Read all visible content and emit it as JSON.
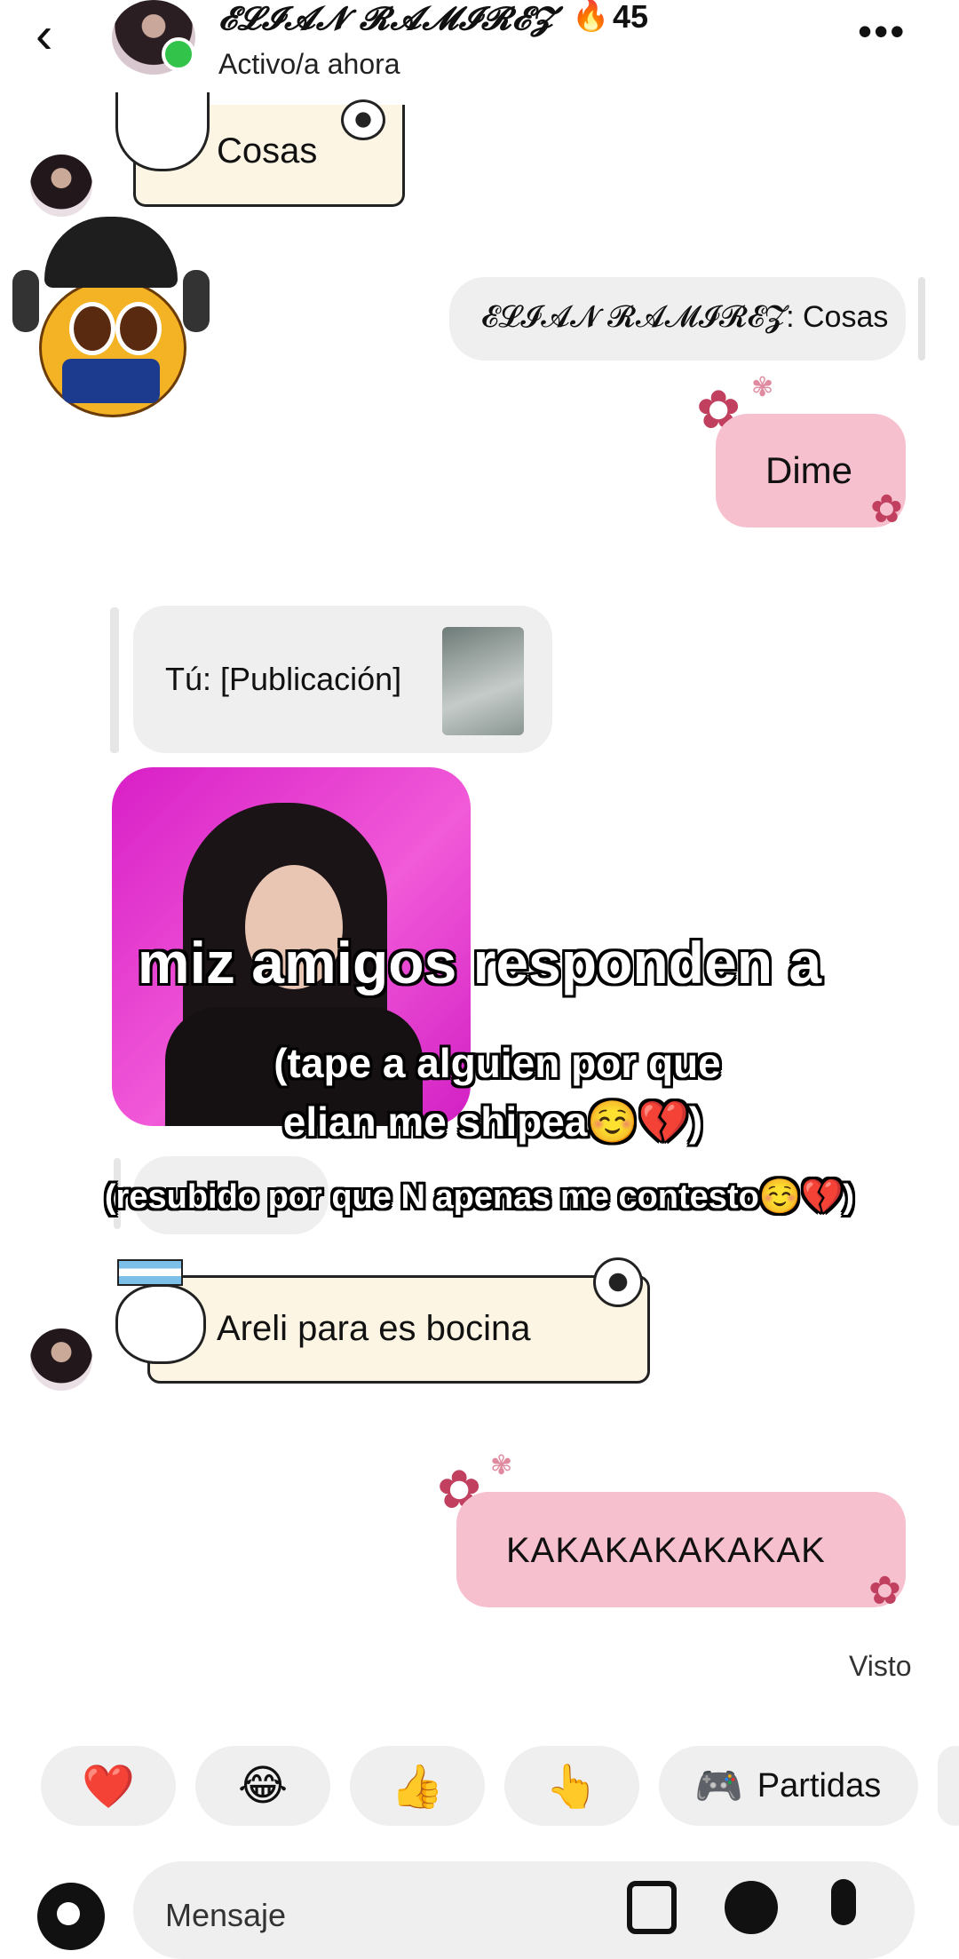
{
  "header": {
    "back_icon": "‹",
    "contact_name": "𝓔𝓛𝓘𝓐𝓝 𝓡𝓐𝓜𝓘𝓡𝓔𝓩",
    "streak_icon": "🔥",
    "streak_count": "45",
    "status": "Activo/a ahora",
    "more_icon": "•••"
  },
  "messages": {
    "sticker_cosas": "Cosas",
    "reply_preview": "𝓔𝓛𝓘𝓐𝓝 𝓡𝓐𝓜𝓘𝓡𝓔𝓩: Cosas",
    "dime": "Dime",
    "shared_post": "Tú: [Publicación]",
    "sticker_areli": "Areli para es bocina",
    "kakaka": "KAKAKAKAKAKAK",
    "seen": "Visto"
  },
  "overlay": {
    "line1": "miz amigos responden a",
    "line2": "(tape a alguien por que",
    "line3": "elian me shipea☺️💔)",
    "line4": "(resubido por que N apenas me contesto☺️💔)"
  },
  "quick_replies": {
    "heart": "❤️",
    "laugh": "😂",
    "thumbs": "👍",
    "point": "👆",
    "games_icon": "🎮",
    "games_label": "Partidas"
  },
  "composer": {
    "placeholder": "Mensaje"
  },
  "colors": {
    "pink_bubble": "#f7c0cf",
    "gray_bubble": "#efefef",
    "sticker_bg": "#fdf5e4",
    "online": "#32c44a"
  }
}
